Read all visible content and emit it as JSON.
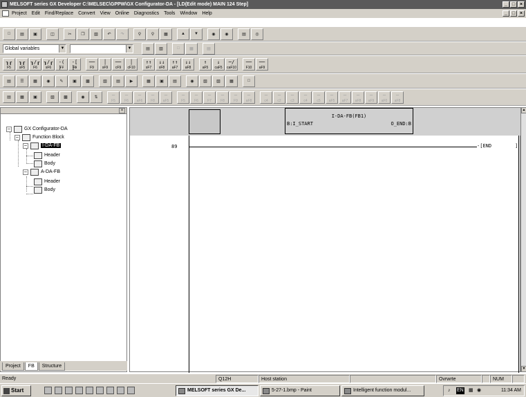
{
  "window": {
    "title": "MELSOFT series GX Developer C:\\MELSEC\\GPPW\\GX Configurator-DA - [LD(Edit mode)   MAIN   124 Step]"
  },
  "menubar": {
    "items": [
      "Project",
      "Edit",
      "Find/Replace",
      "Convert",
      "View",
      "Online",
      "Diagnostics",
      "Tools",
      "Window",
      "Help"
    ]
  },
  "toolbar": {
    "variables_combo": "Global variables",
    "second_combo": ""
  },
  "ladder_fkeys": [
    {
      "sym": "┒┎",
      "label": "F5"
    },
    {
      "sym": "┒┎",
      "label": "sF5"
    },
    {
      "sym": "┒/┎",
      "label": "F6"
    },
    {
      "sym": "┒/┎",
      "label": "sF6"
    },
    {
      "sym": "-( )-",
      "label": "F7"
    },
    {
      "sym": "-[ ]-",
      "label": "F8"
    },
    {
      "sym": "──",
      "label": "F9"
    },
    {
      "sym": "│",
      "label": "sF9"
    },
    {
      "sym": "──",
      "label": "cF9"
    },
    {
      "sym": "│",
      "label": "cF10"
    },
    {
      "sym": "↑↑",
      "label": "sF7"
    },
    {
      "sym": "↓↓",
      "label": "sF8"
    },
    {
      "sym": "↑↑",
      "label": "aF7"
    },
    {
      "sym": "↓↓",
      "label": "aF8"
    },
    {
      "sym": "↑",
      "label": "aF5"
    },
    {
      "sym": "↓",
      "label": "caF5"
    },
    {
      "sym": "─/",
      "label": "caF10"
    },
    {
      "sym": "──",
      "label": "F10"
    },
    {
      "sym": "──",
      "label": "aF9"
    }
  ],
  "sfc_fkeys": [
    "F5",
    "F6",
    "aF6",
    "F8",
    "aF5",
    "F5",
    "F6",
    "F7",
    "F8",
    "F9",
    "aF8",
    "c4",
    "c2",
    "c3",
    "c4",
    "c5",
    "aF5",
    "aF7",
    "aF8",
    "aF9",
    "aF0",
    "aF8"
  ],
  "project_tree": {
    "root": "GX Configurator-DA",
    "function_block": "Function Block",
    "fb1": "I-DA-FB",
    "fb1_header": "Header",
    "fb1_body": "Body",
    "fb2": "A-DA-FB",
    "fb2_header": "Header",
    "fb2_body": "Body"
  },
  "panel_tabs": [
    "Project",
    "FB",
    "Structure"
  ],
  "ladder": {
    "fb_instance": "I-DA-FB(FB1)",
    "fb_input": "B:I_START",
    "fb_output": "O_END:B",
    "step": "89",
    "end_instruction": "END"
  },
  "statusbar": {
    "ready": "Ready",
    "cpu": "Q12H",
    "station": "Host station",
    "mode": "Ovrwrte",
    "num": "NUM"
  },
  "taskbar": {
    "start": "Start",
    "tasks": [
      "MELSOFT series GX De...",
      "5-27-1.bmp - Paint",
      "Intelligent function modul..."
    ],
    "clock": "11:34 AM",
    "lang": "EN"
  }
}
